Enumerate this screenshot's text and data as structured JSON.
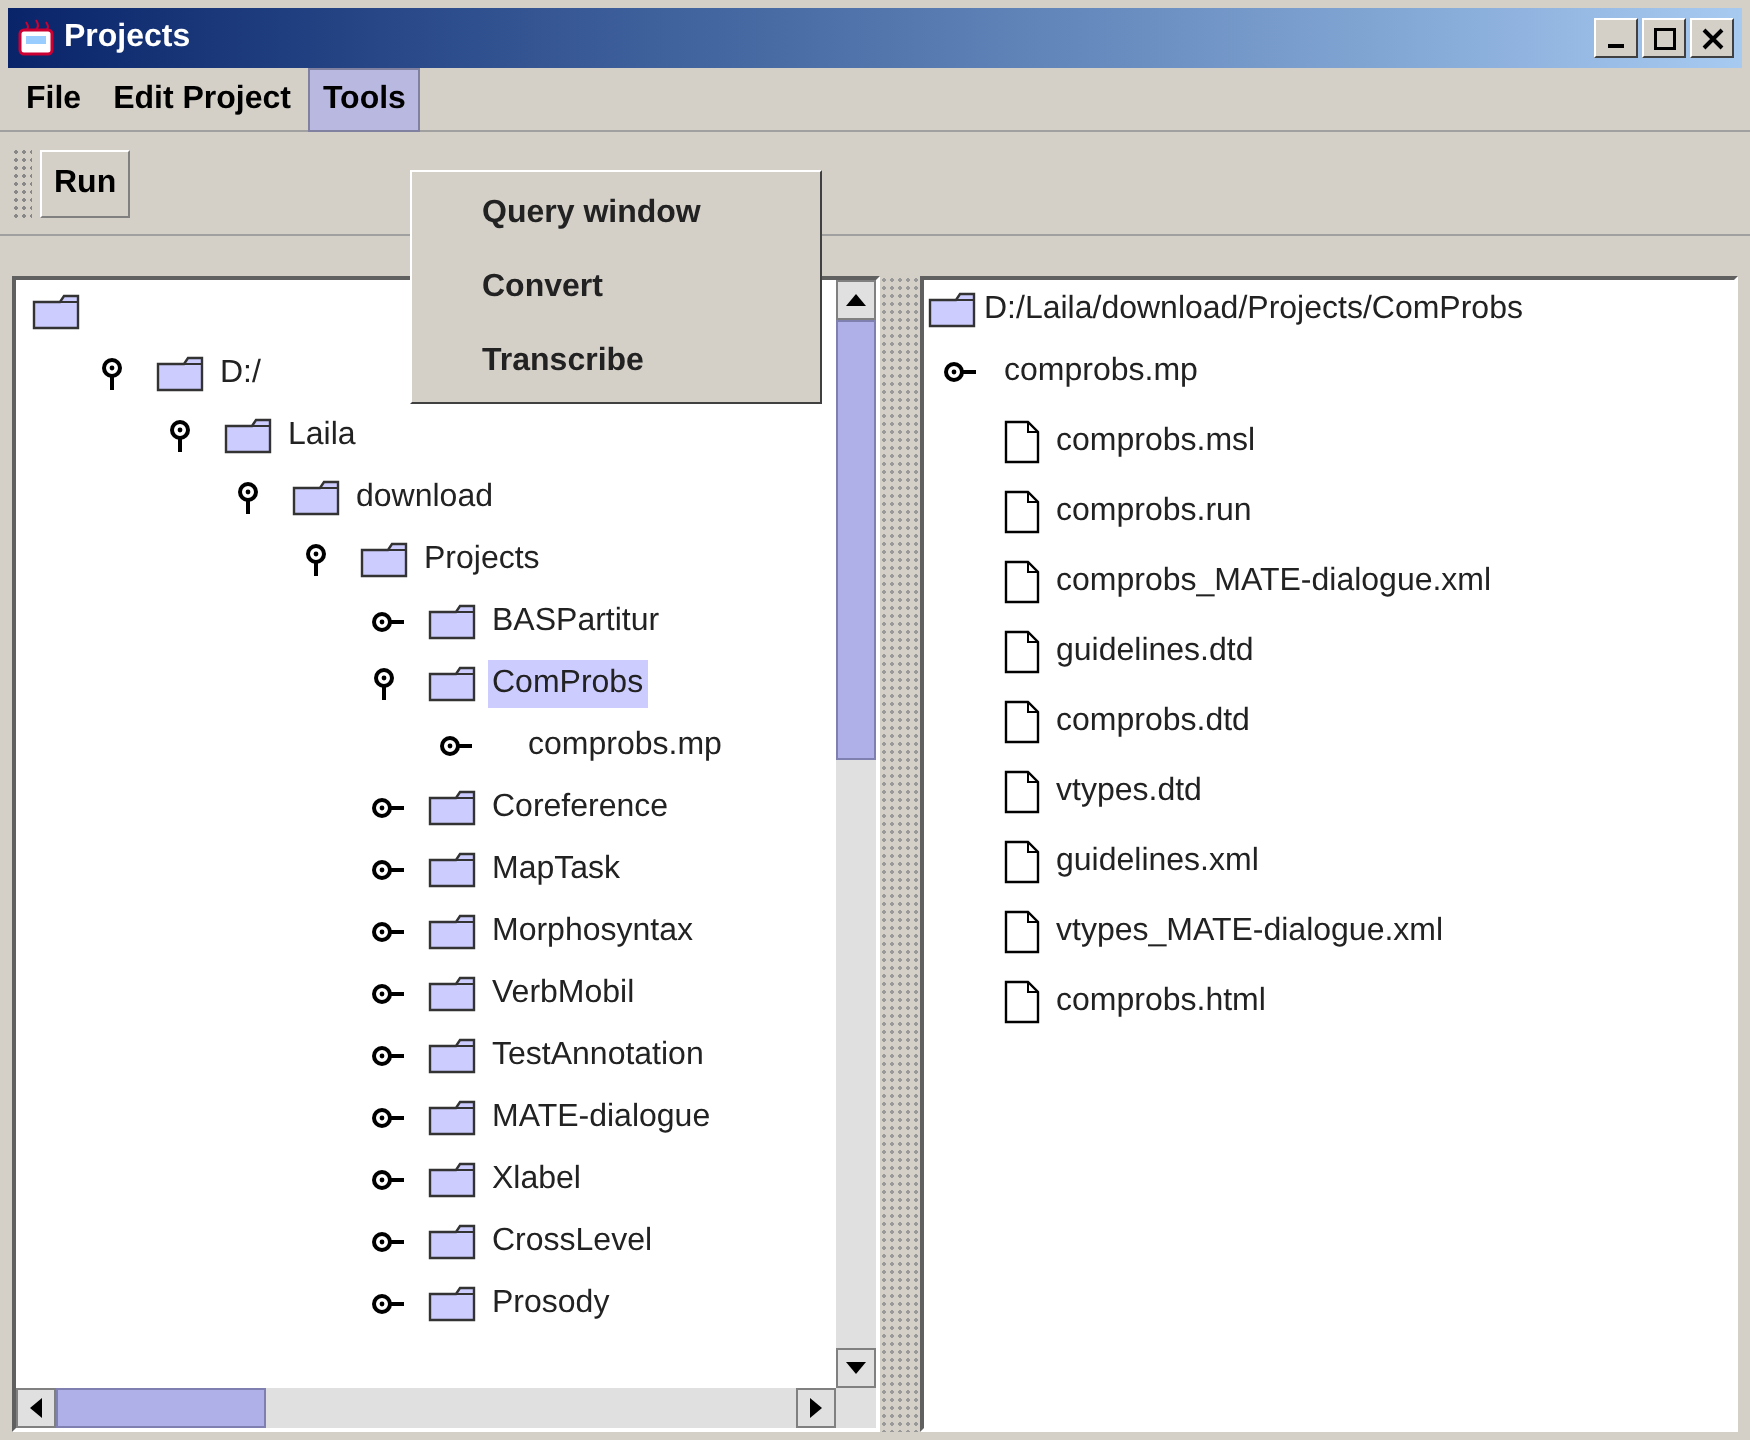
{
  "window": {
    "title": "Projects"
  },
  "menu": [
    {
      "label": "File",
      "selected": false
    },
    {
      "label": "Edit Project",
      "selected": false
    },
    {
      "label": "Tools",
      "selected": true
    }
  ],
  "tools_menu": [
    "Query window",
    "Convert",
    "Transcribe"
  ],
  "toolbar": [
    "Run"
  ],
  "tree": [
    {
      "kind": "folder",
      "children": [
        {
          "kind": "folder",
          "label": "D:/",
          "expanded": true,
          "selected": false,
          "children": [
            {
              "kind": "folder",
              "label": "Laila",
              "expanded": true,
              "selected": false,
              "children": [
                {
                  "kind": "folder",
                  "label": "download",
                  "expanded": true,
                  "selected": false,
                  "children": [
                    {
                      "kind": "folder",
                      "label": "Projects",
                      "expanded": true,
                      "selected": false,
                      "children": [
                        {
                          "kind": "folder",
                          "label": "BASPartitur",
                          "expanded": false,
                          "selected": false
                        },
                        {
                          "kind": "folder",
                          "label": "ComProbs",
                          "expanded": true,
                          "selected": true,
                          "children": [
                            {
                              "kind": "project",
                              "label": "comprobs.mp",
                              "expanded": false,
                              "selected": false
                            }
                          ]
                        },
                        {
                          "kind": "folder",
                          "label": "Coreference",
                          "expanded": false,
                          "selected": false
                        },
                        {
                          "kind": "folder",
                          "label": "MapTask",
                          "expanded": false,
                          "selected": false
                        },
                        {
                          "kind": "folder",
                          "label": "Morphosyntax",
                          "expanded": false,
                          "selected": false
                        },
                        {
                          "kind": "folder",
                          "label": "VerbMobil",
                          "expanded": false,
                          "selected": false
                        },
                        {
                          "kind": "folder",
                          "label": "TestAnnotation",
                          "expanded": false,
                          "selected": false
                        },
                        {
                          "kind": "folder",
                          "label": "MATE-dialogue",
                          "expanded": false,
                          "selected": false
                        },
                        {
                          "kind": "folder",
                          "label": "Xlabel",
                          "expanded": false,
                          "selected": false
                        },
                        {
                          "kind": "folder",
                          "label": "CrossLevel",
                          "expanded": false,
                          "selected": false
                        },
                        {
                          "kind": "folder",
                          "label": "Prosody",
                          "expanded": false,
                          "selected": false
                        }
                      ]
                    }
                  ]
                }
              ]
            }
          ]
        }
      ]
    }
  ],
  "files_panel": {
    "path": "D:/Laila/download/Projects/ComProbs",
    "items": [
      {
        "kind": "project",
        "label": "comprobs.mp"
      },
      {
        "kind": "file",
        "label": "comprobs.msl"
      },
      {
        "kind": "file",
        "label": "comprobs.run"
      },
      {
        "kind": "file",
        "label": "comprobs_MATE-dialogue.xml"
      },
      {
        "kind": "file",
        "label": "guidelines.dtd"
      },
      {
        "kind": "file",
        "label": "comprobs.dtd"
      },
      {
        "kind": "file",
        "label": "vtypes.dtd"
      },
      {
        "kind": "file",
        "label": "guidelines.xml"
      },
      {
        "kind": "file",
        "label": "vtypes_MATE-dialogue.xml"
      },
      {
        "kind": "file",
        "label": "comprobs.html"
      }
    ]
  }
}
